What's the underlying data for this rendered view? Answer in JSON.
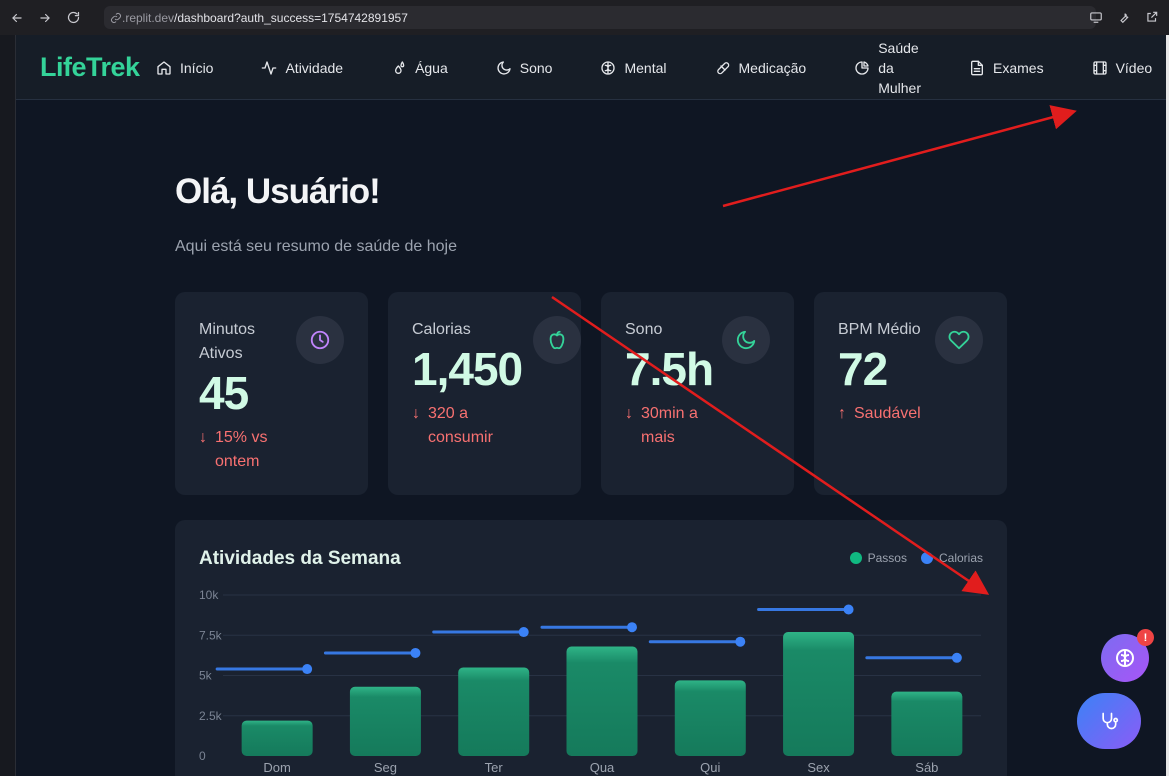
{
  "browser": {
    "url_host": ".replit.dev",
    "url_path": "/dashboard?auth_success=1754742891957"
  },
  "app": {
    "logo": "LifeTrek",
    "nav": [
      {
        "label": "Início",
        "icon": "home-icon"
      },
      {
        "label": "Atividade",
        "icon": "activity-icon"
      },
      {
        "label": "Água",
        "icon": "droplets-icon"
      },
      {
        "label": "Sono",
        "icon": "moon-icon"
      },
      {
        "label": "Mental",
        "icon": "brain-icon"
      },
      {
        "label": "Medicação",
        "icon": "pill-icon"
      },
      {
        "label_lines": [
          "Saúde",
          "da",
          "Mulher"
        ],
        "icon": "pie-chart-icon"
      },
      {
        "label": "Exames",
        "icon": "file-text-icon"
      },
      {
        "label": "Vídeo",
        "icon": "film-icon"
      }
    ]
  },
  "main": {
    "greeting": "Olá, Usuário!",
    "subtitle": "Aqui está seu resumo de saúde de hoje"
  },
  "cards": [
    {
      "label_lines": [
        "Minutos",
        "Ativos"
      ],
      "value": "45",
      "trend_arrow": "↓",
      "trend_lines": [
        "15% vs",
        "ontem"
      ],
      "icon": "clock-icon",
      "icon_color": "#c084fc"
    },
    {
      "label_lines": [
        "Calorias"
      ],
      "value": "1,450",
      "trend_arrow": "↓",
      "trend_lines": [
        "320 a",
        "consumir"
      ],
      "icon": "apple-icon",
      "icon_color": "#34d399"
    },
    {
      "label_lines": [
        "Sono"
      ],
      "value": "7.5h",
      "trend_arrow": "↓",
      "trend_lines": [
        "30min a",
        "mais"
      ],
      "icon": "moon-icon",
      "icon_color": "#34d399"
    },
    {
      "label_lines": [
        "BPM Médio"
      ],
      "value": "72",
      "trend_arrow": "↑",
      "trend_lines": [
        "Saudável"
      ],
      "icon": "heart-icon",
      "icon_color": "#34d399"
    }
  ],
  "colors": {
    "accent": "#34d399",
    "bar": "#1a8a67",
    "calorias_line": "#3b82f6",
    "trend_negative": "#f87171"
  },
  "chart_data": {
    "type": "bar",
    "title": "Atividades da Semana",
    "categories": [
      "Dom",
      "Seg",
      "Ter",
      "Qua",
      "Qui",
      "Sex",
      "Sáb"
    ],
    "yticks": [
      "0",
      "2.5k",
      "5k",
      "7.5k",
      "10k"
    ],
    "ylim": [
      0,
      10000
    ],
    "grid": true,
    "legend_position": "top-right",
    "series": [
      {
        "name": "Passos",
        "type": "bar",
        "color": "#10b981",
        "values": [
          2200,
          4300,
          5500,
          6800,
          4700,
          7700,
          4000
        ]
      },
      {
        "name": "Calorias",
        "type": "line",
        "color": "#3b82f6",
        "values": [
          5400,
          6400,
          7700,
          8000,
          7100,
          9100,
          6100
        ]
      }
    ]
  },
  "fab": {
    "badge": "!",
    "brain_icon": "brain-icon",
    "steth_icon": "stethoscope-icon"
  }
}
